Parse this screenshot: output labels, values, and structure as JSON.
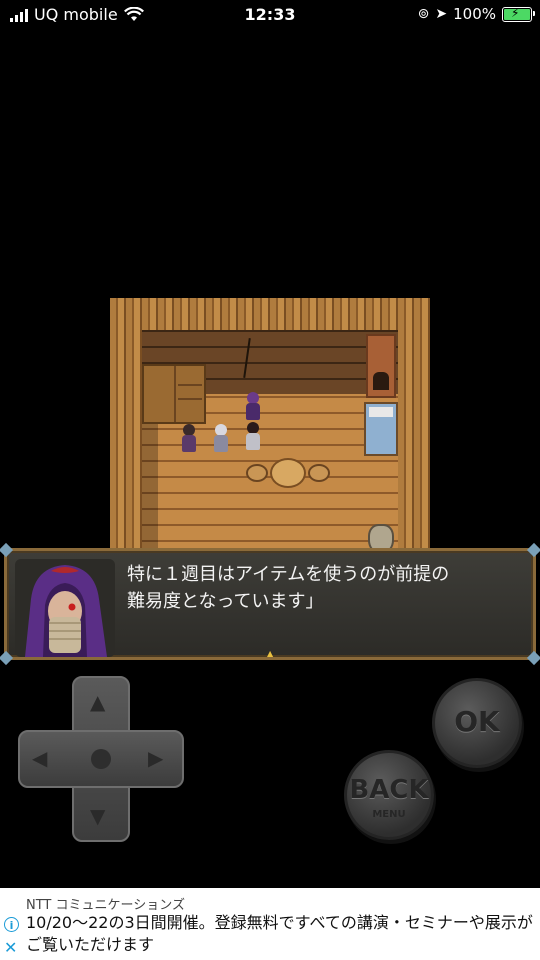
{
  "status_bar": {
    "carrier": "UQ mobile",
    "time": "12:33",
    "battery": "100%"
  },
  "dialog": {
    "line1": "特に１週目はアイテムを使うのが前提の",
    "line2": "難易度となっています」"
  },
  "controls": {
    "ok_label": "OK",
    "back_label": "BACK",
    "back_sub": "MENU"
  },
  "ad": {
    "sponsor": "NTT コミュニケーションズ",
    "text": "10/20〜22の3日間開催。登録無料ですべての講演・セミナーや展示がご覧いただけます"
  },
  "colors": {
    "window_border": "#8a6a3a",
    "ad_accent": "#1a9bd7"
  }
}
